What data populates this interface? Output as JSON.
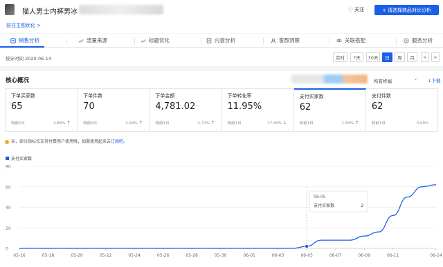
{
  "header": {
    "product_title": "猫人男士内裤男冰",
    "follow_label": "关注",
    "compare_button": "请选择商品对比分析",
    "sublink": "前往主图优化 >"
  },
  "tabs": [
    {
      "label": "销售分析",
      "icon": "sales-icon",
      "active": true
    },
    {
      "label": "流量来源",
      "icon": "trend-icon",
      "active": false
    },
    {
      "label": "标题优化",
      "icon": "trend-icon",
      "active": false
    },
    {
      "label": "内容分析",
      "icon": "doc-icon",
      "active": false
    },
    {
      "label": "客群洞察",
      "icon": "user-icon",
      "active": false
    },
    {
      "label": "关联搭配",
      "icon": "link-icon",
      "active": false
    },
    {
      "label": "服务分析",
      "icon": "service-icon",
      "active": false
    }
  ],
  "date_bar": {
    "stat_time": "统计时间 2020-06-14",
    "ranges": [
      "实时",
      "7天",
      "30天",
      "日",
      "周",
      "月"
    ],
    "active_range": "日",
    "prev": "<",
    "next": ">"
  },
  "core": {
    "title": "核心概况",
    "select_all": "所有终端",
    "download": "下载",
    "metrics": [
      {
        "label": "下单买家数",
        "value": "65",
        "compare": "较前1日",
        "pct": "4.84%",
        "dir": "up",
        "active": false
      },
      {
        "label": "下单件数",
        "value": "70",
        "compare": "较前1日",
        "pct": "2.94%",
        "dir": "up",
        "active": false
      },
      {
        "label": "下单金额",
        "value": "4,781.02",
        "compare": "较前1日",
        "pct": "2.72%",
        "dir": "up",
        "active": false
      },
      {
        "label": "下单转化率",
        "value": "11.95%",
        "compare": "较前1日",
        "pct": "17.90%",
        "dir": "down",
        "active": false
      },
      {
        "label": "支付买家数",
        "value": "62",
        "compare": "较前1日",
        "pct": "1.64%",
        "dir": "up",
        "active": true
      },
      {
        "label": "支付件数",
        "value": "62",
        "compare": "较前1日",
        "pct": "0.00%",
        "dir": "flat",
        "active": false
      }
    ],
    "notice": "亲，部分指标仅支持付费用户使用哦，如需使用起来去",
    "notice_link": "订阅吧。"
  },
  "chart_data": {
    "type": "line",
    "series": [
      {
        "name": "支付买家数",
        "values": [
          0,
          0,
          0,
          0,
          0,
          0,
          0,
          0,
          0,
          0,
          0,
          0,
          0,
          0,
          0,
          0,
          0,
          0,
          0,
          0,
          2,
          8,
          8,
          8,
          12,
          16,
          32,
          50,
          60,
          62
        ]
      }
    ],
    "x": [
      "05-16",
      "05-17",
      "05-18",
      "05-19",
      "05-20",
      "05-21",
      "05-22",
      "05-23",
      "05-24",
      "05-25",
      "05-26",
      "05-27",
      "05-28",
      "05-29",
      "05-30",
      "05-31",
      "06-01",
      "06-02",
      "06-03",
      "06-04",
      "06-05",
      "06-06",
      "06-07",
      "06-08",
      "06-09",
      "06-10",
      "06-11",
      "06-12",
      "06-13",
      "06-14"
    ],
    "x_tick_labels": [
      "05-16",
      "05-18",
      "05-20",
      "05-22",
      "05-24",
      "05-26",
      "05-28",
      "05-30",
      "06-01",
      "06-03",
      "06-05",
      "06-07",
      "06-09",
      "06-11",
      "06-14"
    ],
    "y_ticks": [
      0,
      20,
      40,
      60,
      80
    ],
    "ylim": [
      0,
      80
    ],
    "tooltip": {
      "date": "06-05",
      "label": "支付买家数",
      "value": "2"
    },
    "color": "#1a5fe6"
  }
}
